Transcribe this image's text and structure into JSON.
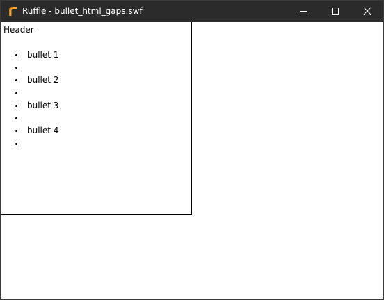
{
  "window": {
    "title": "Ruffle - bullet_html_gaps.swf",
    "app_icon": "ruffle-logo-icon",
    "controls": {
      "minimize": "minimize-icon",
      "maximize": "maximize-icon",
      "close": "close-icon"
    }
  },
  "content": {
    "header": "Header",
    "bullets": [
      {
        "text": "bullet 1"
      },
      {
        "text": ""
      },
      {
        "text": "bullet 2"
      },
      {
        "text": ""
      },
      {
        "text": "bullet 3"
      },
      {
        "text": ""
      },
      {
        "text": "bullet 4"
      },
      {
        "text": ""
      }
    ]
  },
  "colors": {
    "titlebar": "#2b2b2b",
    "logo": "#f5a623"
  }
}
